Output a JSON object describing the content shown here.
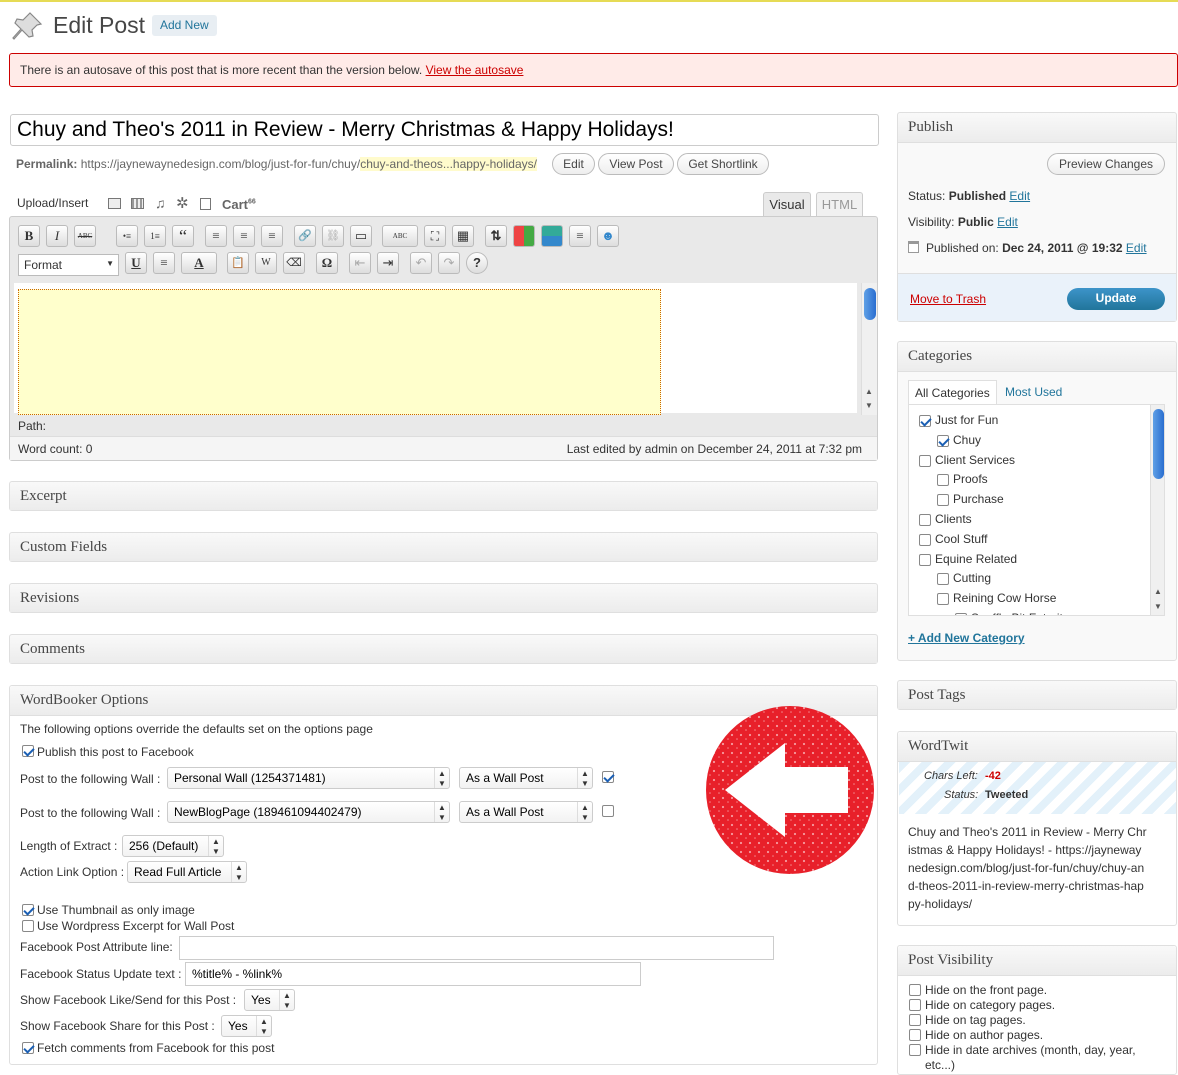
{
  "header": {
    "title": "Edit Post",
    "add_new": "Add New"
  },
  "notice": {
    "text": "There is an autosave of this post that is more recent than the version below.",
    "link": "View the autosave"
  },
  "post": {
    "title": "Chuy and Theo's 2011 in Review - Merry Christmas & Happy Holidays!",
    "permalink_label": "Permalink:",
    "permalink_base": "https://jaynewaynedesign.com/blog/just-for-fun/chuy/",
    "permalink_slug": "chuy-and-theos...happy-holidays/",
    "edit_btn": "Edit",
    "view_btn": "View Post",
    "shortlink_btn": "Get Shortlink"
  },
  "editor": {
    "upload_label": "Upload/Insert",
    "cart_label": "Cart",
    "cart_sup": "66",
    "tab_visual": "Visual",
    "tab_html": "HTML",
    "format_select": "Format",
    "path_label": "Path:",
    "word_count": "Word count: 0",
    "last_edited": "Last edited by admin on December 24, 2011 at 7:32 pm",
    "toolbar1": [
      "B",
      "I",
      "ABC",
      "•≡",
      "1≡",
      "“",
      "≡",
      "≡",
      "≡",
      "🔗",
      "⛓",
      "▭",
      "ABC",
      "⛶",
      "▦"
    ],
    "toolbar2": [
      "U",
      "≡",
      "A",
      "📋",
      "W",
      "⌫",
      "Ω",
      "⇤",
      "⇥",
      "↶",
      "↷",
      "?"
    ]
  },
  "panels": {
    "excerpt": "Excerpt",
    "custom_fields": "Custom Fields",
    "revisions": "Revisions",
    "comments": "Comments"
  },
  "wordbooker": {
    "title": "WordBooker Options",
    "intro": "The following options override the defaults set on the options page",
    "publish_fb": "Publish this post to Facebook",
    "wall_label": "Post to the following Wall :",
    "wall1": "Personal Wall (1254371481)",
    "wall1_type": "As a Wall Post",
    "wall2": "NewBlogPage (189461094402479)",
    "wall2_type": "As a Wall Post",
    "extract_label": "Length of Extract :",
    "extract_value": "256 (Default)",
    "action_label": "Action Link Option :",
    "action_value": "Read Full Article",
    "thumb_only": "Use Thumbnail as only image",
    "wp_excerpt": "Use Wordpress Excerpt for Wall Post",
    "attr_line_label": "Facebook Post Attribute line:",
    "attr_line_value": "",
    "status_label": "Facebook Status Update text :",
    "status_value": "%title% - %link%",
    "like_label": "Show Facebook Like/Send for this Post :",
    "like_value": "Yes",
    "share_label": "Show Facebook Share for this Post :",
    "share_value": "Yes",
    "fetch_label": "Fetch comments from Facebook for this post"
  },
  "publish": {
    "title": "Publish",
    "preview": "Preview Changes",
    "status_label": "Status:",
    "status_value": "Published",
    "visibility_label": "Visibility:",
    "visibility_value": "Public",
    "published_on_label": "Published on:",
    "published_on_value": "Dec 24, 2011 @ 19:32",
    "edit": "Edit",
    "trash": "Move to Trash",
    "update": "Update"
  },
  "categories": {
    "title": "Categories",
    "tab_all": "All Categories",
    "tab_used": "Most Used",
    "items": [
      {
        "label": "Just for Fun",
        "checked": true
      },
      {
        "label": "Chuy",
        "checked": true
      },
      {
        "label": "Client Services",
        "checked": false
      },
      {
        "label": "Proofs",
        "checked": false
      },
      {
        "label": "Purchase",
        "checked": false
      },
      {
        "label": "Clients",
        "checked": false
      },
      {
        "label": "Cool Stuff",
        "checked": false
      },
      {
        "label": "Equine Related",
        "checked": false
      },
      {
        "label": "Cutting",
        "checked": false
      },
      {
        "label": "Reining Cow Horse",
        "checked": false
      },
      {
        "label": "Snaffle Bit Futurity",
        "checked": false
      }
    ],
    "add_new": "+ Add New Category"
  },
  "post_tags": {
    "title": "Post Tags"
  },
  "wordtwit": {
    "title": "WordTwit",
    "chars_left_label": "Chars Left:",
    "chars_left_value": "-42",
    "status_label": "Status:",
    "status_value": "Tweeted",
    "tweet_text": "Chuy and Theo's 2011 in Review - Merry Christmas & Happy Holidays! - https://jaynewaynedesign.com/blog/just-for-fun/chuy/chuy-and-theos-2011-in-review-merry-christmas-happy-holidays/"
  },
  "post_visibility": {
    "title": "Post Visibility",
    "items": [
      "Hide on the front page.",
      "Hide on category pages.",
      "Hide on tag pages.",
      "Hide on author pages.",
      "Hide in date archives (month, day, year, etc...)"
    ]
  },
  "colors": {
    "link": "#21759b",
    "update_btn": "#21759b",
    "notice_bg": "#ffebe8",
    "notice_border": "#cc0000",
    "stamp": "#e8202a"
  }
}
